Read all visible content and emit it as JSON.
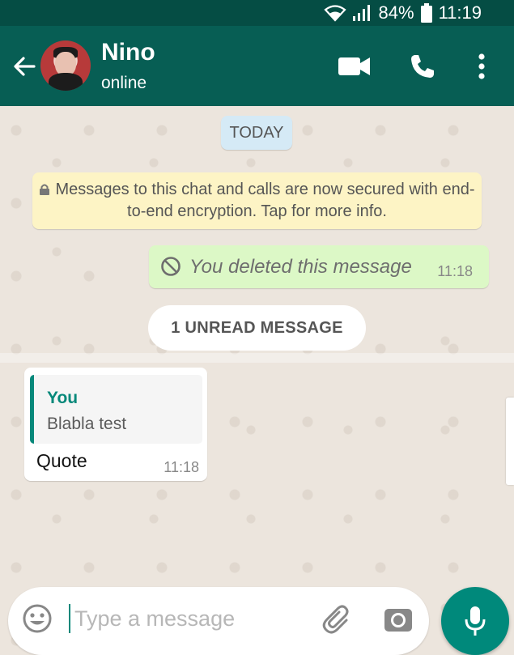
{
  "status_bar": {
    "battery": "84%",
    "time": "11:19"
  },
  "header": {
    "name": "Nino",
    "status": "online"
  },
  "chat": {
    "date_chip": "TODAY",
    "encryption_notice": "Messages to this chat and calls are now secured with end-to-end encryption. Tap for more info.",
    "deleted_message": {
      "text": "You deleted this message",
      "time": "11:18"
    },
    "unread_label": "1 UNREAD MESSAGE",
    "incoming_message": {
      "quote_author": "You",
      "quote_text": "Blabla test",
      "text": "Quote",
      "time": "11:18"
    }
  },
  "input": {
    "placeholder": "Type a message"
  },
  "colors": {
    "header": "#075e54",
    "status_bar": "#054d44",
    "accent": "#00897b",
    "outgoing_bubble": "#dcf8c6",
    "notice_bg": "#fdf4c5",
    "chat_bg": "#ece5dd"
  },
  "icons": [
    "wifi-icon",
    "signal-icon",
    "battery-icon",
    "back-arrow-icon",
    "video-call-icon",
    "voice-call-icon",
    "more-options-icon",
    "lock-icon",
    "deleted-icon",
    "emoji-icon",
    "attach-icon",
    "camera-icon",
    "mic-icon"
  ]
}
